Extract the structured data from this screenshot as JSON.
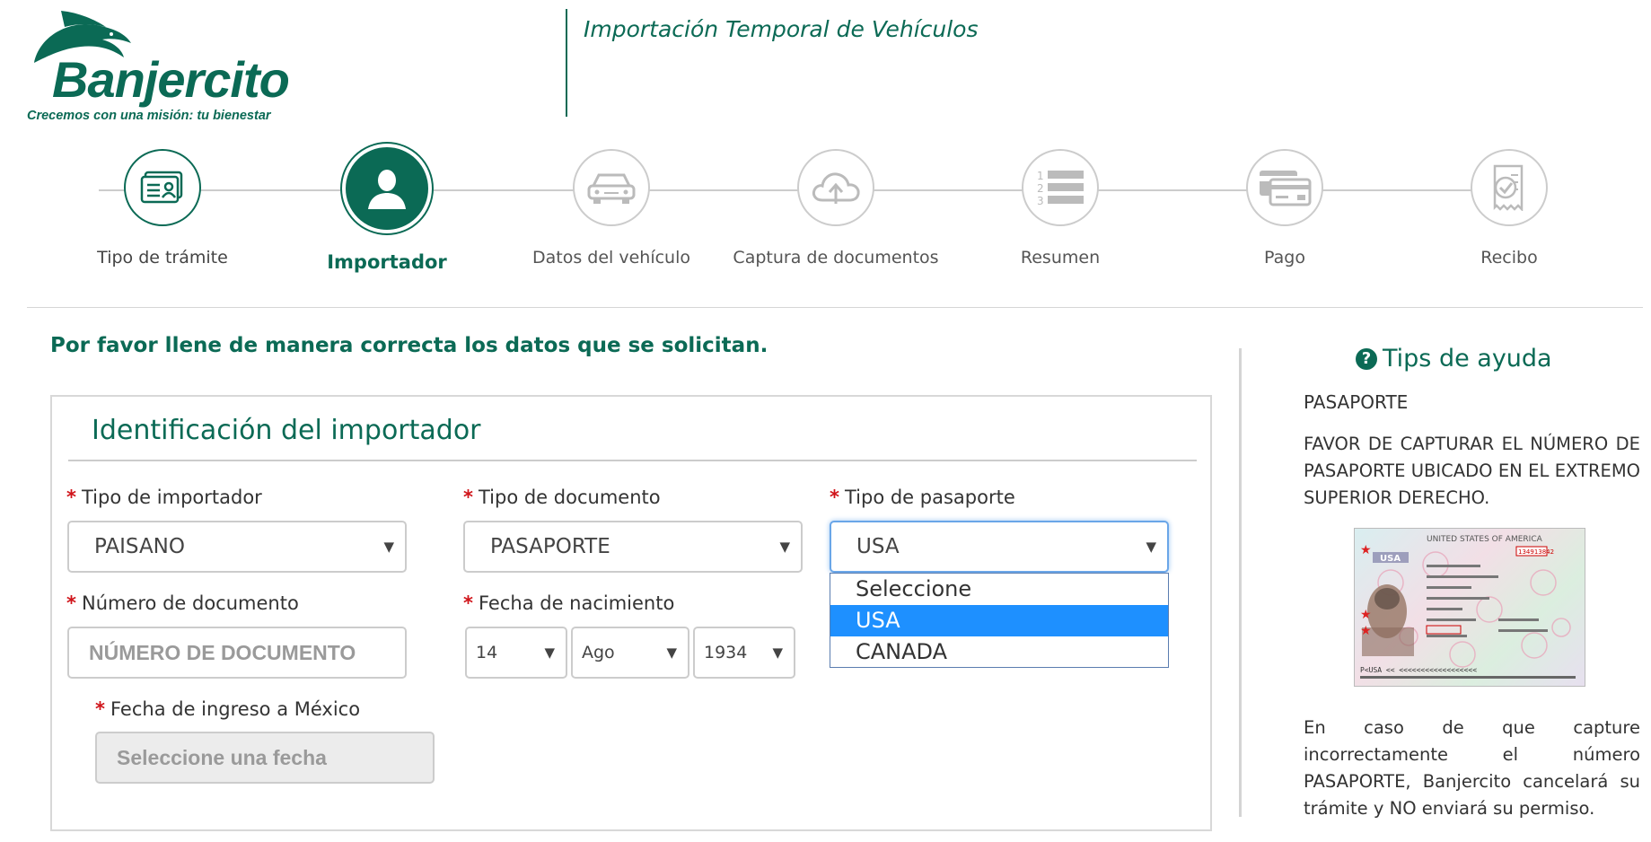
{
  "brand": {
    "name": "Banjercito",
    "tagline": "Crecemos con una misión: tu bienestar",
    "color": "#0b6a55"
  },
  "header": {
    "title": "Importación Temporal de Vehículos"
  },
  "steps": [
    {
      "label": "Tipo de trámite",
      "icon": "id-card-icon",
      "state": "done"
    },
    {
      "label": "Importador",
      "icon": "user-icon",
      "state": "active"
    },
    {
      "label": "Datos del vehículo",
      "icon": "car-icon",
      "state": "pending"
    },
    {
      "label": "Captura de documentos",
      "icon": "cloud-upload-icon",
      "state": "pending"
    },
    {
      "label": "Resumen",
      "icon": "numbered-list-icon",
      "state": "pending"
    },
    {
      "label": "Pago",
      "icon": "payment-card-icon",
      "state": "pending"
    },
    {
      "label": "Recibo",
      "icon": "receipt-check-icon",
      "state": "pending"
    }
  ],
  "instructions": "Por favor llene de manera correcta los datos que se solicitan.",
  "form": {
    "title": "Identificación del importador",
    "required_mark": "*",
    "tipo_importador": {
      "label": "Tipo de importador",
      "value": "PAISANO"
    },
    "tipo_documento": {
      "label": "Tipo de documento",
      "value": "PASAPORTE"
    },
    "tipo_pasaporte": {
      "label": "Tipo de pasaporte",
      "value": "USA",
      "options": [
        "Seleccione",
        "USA",
        "CANADA"
      ],
      "highlighted": "USA"
    },
    "numero_documento": {
      "label": "Número de documento",
      "placeholder": "NÚMERO DE DOCUMENTO"
    },
    "fecha_nacimiento": {
      "label": "Fecha de nacimiento",
      "day": "14",
      "month": "Ago",
      "year": "1934"
    },
    "fecha_ingreso": {
      "label": "Fecha de ingreso a México",
      "placeholder": "Seleccione una fecha"
    }
  },
  "tips": {
    "title": "Tips de ayuda",
    "subtitle": "PASAPORTE",
    "text1": "FAVOR DE CAPTURAR EL NÚMERO DE PASAPORTE UBICADO EN EL EXTREMO SUPERIOR DERECHO.",
    "passport_country": "UNITED STATES OF AMERICA",
    "passport_number": "134913842",
    "passport_mrz": "P<USA     <<   <<<<<<<<<<<<<<<<<<",
    "text2": "En caso de que capture incorrectamente el número PASAPORTE, Banjercito cancelará su trámite y NO enviará su permiso."
  }
}
